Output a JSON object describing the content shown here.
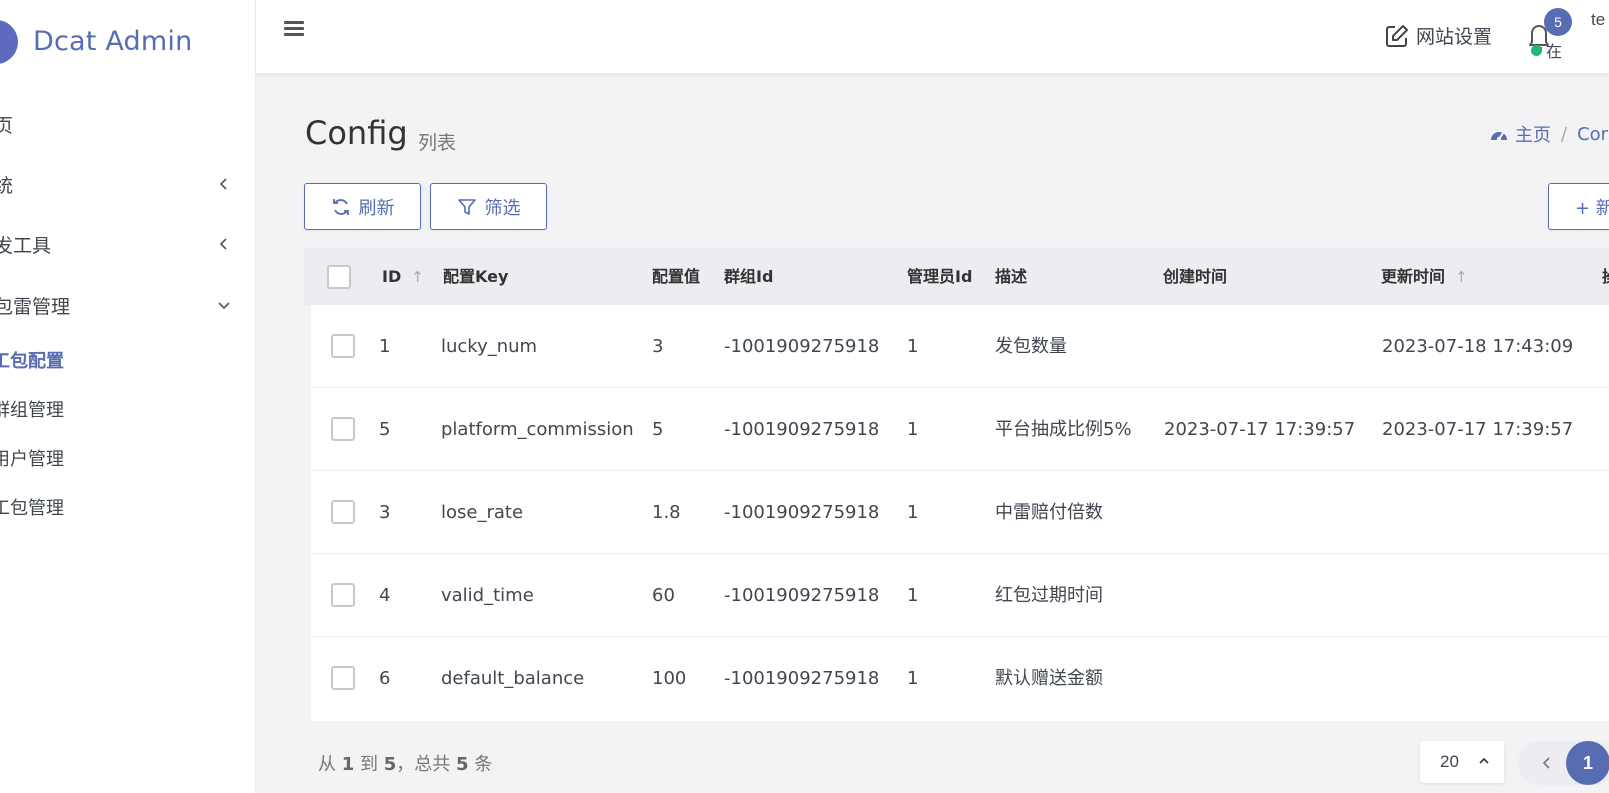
{
  "app": {
    "brand": "Dcat Admin"
  },
  "sidebar": {
    "items": [
      {
        "label": "页",
        "has_chevron": false
      },
      {
        "label": "统",
        "chevron": "left"
      },
      {
        "label": "发工具",
        "chevron": "left"
      },
      {
        "label": "包雷管理",
        "chevron": "down"
      }
    ],
    "sub_items": [
      {
        "label": "工包配置",
        "active": true
      },
      {
        "label": "群组管理",
        "active": false
      },
      {
        "label": "用户管理",
        "active": false
      },
      {
        "label": "工包管理",
        "active": false
      }
    ]
  },
  "topbar": {
    "settings_label": "网站设置",
    "notification_count": "5",
    "user_name": "te",
    "user_status": "在"
  },
  "page": {
    "title": "Config",
    "subtitle": "列表",
    "breadcrumb": {
      "home": "主页",
      "current": "Cor"
    }
  },
  "toolbar": {
    "refresh_label": "刷新",
    "filter_label": "筛选",
    "new_label": "+  新"
  },
  "table": {
    "columns": [
      "ID",
      "配置Key",
      "配置值",
      "群组Id",
      "管理员Id",
      "描述",
      "创建时间",
      "更新时间",
      "操"
    ],
    "rows": [
      {
        "id": "1",
        "key": "lucky_num",
        "value": "3",
        "group_id": "-1001909275918",
        "admin_id": "1",
        "desc": "发包数量",
        "created": "",
        "updated": "2023-07-18 17:43:09"
      },
      {
        "id": "5",
        "key": "platform_commission",
        "value": "5",
        "group_id": "-1001909275918",
        "admin_id": "1",
        "desc": "平台抽成比例5%",
        "created": "2023-07-17 17:39:57",
        "updated": "2023-07-17 17:39:57"
      },
      {
        "id": "3",
        "key": "lose_rate",
        "value": "1.8",
        "group_id": "-1001909275918",
        "admin_id": "1",
        "desc": "中雷赔付倍数",
        "created": "",
        "updated": ""
      },
      {
        "id": "4",
        "key": "valid_time",
        "value": "60",
        "group_id": "-1001909275918",
        "admin_id": "1",
        "desc": "红包过期时间",
        "created": "",
        "updated": ""
      },
      {
        "id": "6",
        "key": "default_balance",
        "value": "100",
        "group_id": "-1001909275918",
        "admin_id": "1",
        "desc": "默认赠送金额",
        "created": "",
        "updated": ""
      }
    ]
  },
  "footer": {
    "from_label": "从",
    "from": "1",
    "to_label": "到",
    "to": "5",
    "total_label": "，总共",
    "total": "5",
    "unit": "条",
    "per_page": "20",
    "current_page": "1"
  },
  "colors": {
    "accent": "#586cb1",
    "status_online": "#21b978",
    "header_bg": "#ececf1"
  }
}
